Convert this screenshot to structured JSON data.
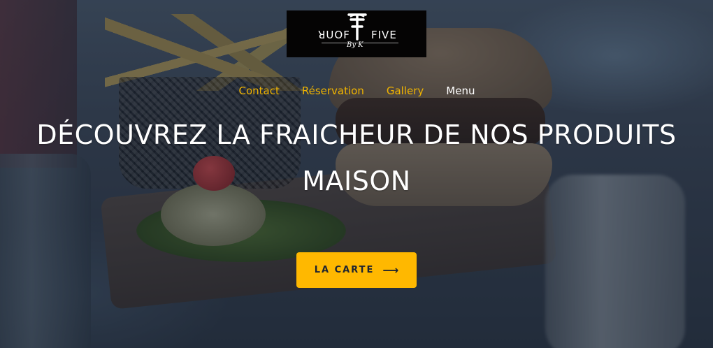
{
  "brand": {
    "left_word": "ꓤUOF",
    "right_word": "FIVE",
    "signature": "By K"
  },
  "nav": {
    "items": [
      {
        "label": "Contact",
        "active": false
      },
      {
        "label": "Réservation",
        "active": false
      },
      {
        "label": "Gallery",
        "active": false
      },
      {
        "label": "Menu",
        "active": true
      }
    ]
  },
  "hero": {
    "title": "DÉCOUVREZ LA FRAICHEUR DE NOS PRODUITS MAISON",
    "cta_label": "LA CARTE",
    "cta_icon": "arrow-right-icon"
  },
  "colors": {
    "accent": "#ffb800",
    "nav_link": "#f0b400",
    "nav_active": "#ffffff",
    "logo_bg": "#050404"
  }
}
